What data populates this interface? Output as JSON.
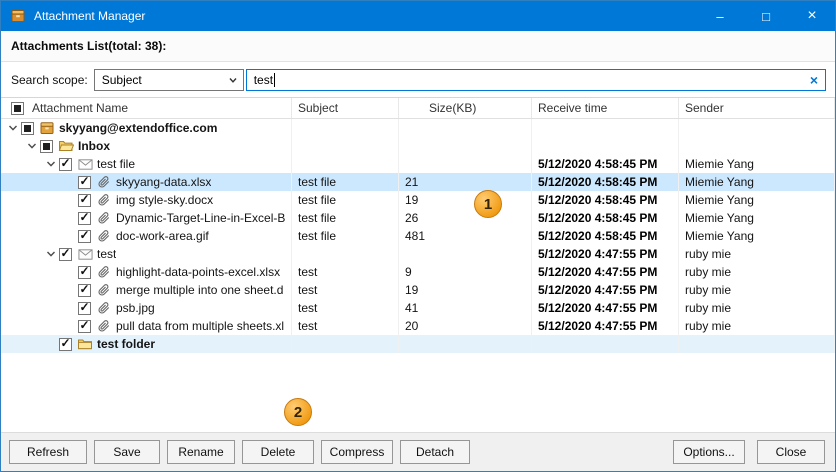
{
  "window": {
    "title": "Attachment Manager",
    "controls": {
      "minimize": "–",
      "maximize": "□",
      "close": "×"
    }
  },
  "header": {
    "attachments_list_label": "Attachments List(total: 38):"
  },
  "search": {
    "scope_label": "Search scope:",
    "scope_value": "Subject",
    "query": "test",
    "clear_glyph": "×"
  },
  "table": {
    "columns": [
      "Attachment Name",
      "Subject",
      "Size(KB)",
      "Receive time",
      "Sender"
    ],
    "header_checkbox": "indeterminate",
    "rows": [
      {
        "name": "skyyang@extendoffice.com",
        "subject": "",
        "size": "",
        "receive_time": "",
        "sender": "",
        "level": 0,
        "icon": "mailbox",
        "checkbox": "indeterminate",
        "bold": true,
        "expander": true,
        "highlight": "none"
      },
      {
        "name": "Inbox",
        "subject": "",
        "size": "",
        "receive_time": "",
        "sender": "",
        "level": 1,
        "icon": "folder-open",
        "checkbox": "indeterminate",
        "bold": true,
        "expander": true,
        "highlight": "none"
      },
      {
        "name": "test file",
        "subject": "",
        "size": "",
        "receive_time": "5/12/2020 4:58:45 PM",
        "sender": "Miemie Yang",
        "level": 2,
        "icon": "mail",
        "checkbox": "checked",
        "bold": false,
        "expander": true,
        "highlight": "none"
      },
      {
        "name": "skyyang-data.xlsx",
        "subject": "test file",
        "size": "21",
        "receive_time": "5/12/2020 4:58:45 PM",
        "sender": "Miemie Yang",
        "level": 3,
        "icon": "paperclip",
        "checkbox": "checked",
        "bold": false,
        "expander": false,
        "highlight": "selected"
      },
      {
        "name": "img style-sky.docx",
        "subject": "test file",
        "size": "19",
        "receive_time": "5/12/2020 4:58:45 PM",
        "sender": "Miemie Yang",
        "level": 3,
        "icon": "paperclip",
        "checkbox": "checked",
        "bold": false,
        "expander": false,
        "highlight": "none"
      },
      {
        "name": "Dynamic-Target-Line-in-Excel-B",
        "subject": "test file",
        "size": "26",
        "receive_time": "5/12/2020 4:58:45 PM",
        "sender": "Miemie Yang",
        "level": 3,
        "icon": "paperclip",
        "checkbox": "checked",
        "bold": false,
        "expander": false,
        "highlight": "none"
      },
      {
        "name": "doc-work-area.gif",
        "subject": "test file",
        "size": "481",
        "receive_time": "5/12/2020 4:58:45 PM",
        "sender": "Miemie Yang",
        "level": 3,
        "icon": "paperclip",
        "checkbox": "checked",
        "bold": false,
        "expander": false,
        "highlight": "none"
      },
      {
        "name": "test",
        "subject": "",
        "size": "",
        "receive_time": "5/12/2020 4:47:55 PM",
        "sender": "ruby mie",
        "level": 2,
        "icon": "mail",
        "checkbox": "checked",
        "bold": false,
        "expander": true,
        "highlight": "none"
      },
      {
        "name": "highlight-data-points-excel.xlsx",
        "subject": "test",
        "size": "9",
        "receive_time": "5/12/2020 4:47:55 PM",
        "sender": "ruby mie",
        "level": 3,
        "icon": "paperclip",
        "checkbox": "checked",
        "bold": false,
        "expander": false,
        "highlight": "none"
      },
      {
        "name": "merge multiple into one sheet.d",
        "subject": "test",
        "size": "19",
        "receive_time": "5/12/2020 4:47:55 PM",
        "sender": "ruby mie",
        "level": 3,
        "icon": "paperclip",
        "checkbox": "checked",
        "bold": false,
        "expander": false,
        "highlight": "none"
      },
      {
        "name": "psb.jpg",
        "subject": "test",
        "size": "41",
        "receive_time": "5/12/2020 4:47:55 PM",
        "sender": "ruby mie",
        "level": 3,
        "icon": "paperclip",
        "checkbox": "checked",
        "bold": false,
        "expander": false,
        "highlight": "none"
      },
      {
        "name": "pull data from multiple sheets.xl",
        "subject": "test",
        "size": "20",
        "receive_time": "5/12/2020 4:47:55 PM",
        "sender": "ruby mie",
        "level": 3,
        "icon": "paperclip",
        "checkbox": "checked",
        "bold": false,
        "expander": false,
        "highlight": "none"
      },
      {
        "name": "test folder",
        "subject": "",
        "size": "",
        "receive_time": "",
        "sender": "",
        "level": 2,
        "icon": "folder",
        "checkbox": "checked",
        "bold": true,
        "expander": false,
        "highlight": "light"
      }
    ]
  },
  "annotations": [
    {
      "label": "1"
    },
    {
      "label": "2"
    }
  ],
  "buttons": {
    "left": [
      "Refresh",
      "Save",
      "Rename",
      "Delete",
      "Compress",
      "Detach"
    ],
    "right": [
      "Options...",
      "Close"
    ]
  },
  "colors": {
    "titlebar": "#0078d7",
    "selected_row": "#cce8ff",
    "light_row": "#e4f2fc",
    "annotation": "#f0990f",
    "focus_border": "#0078d7"
  }
}
